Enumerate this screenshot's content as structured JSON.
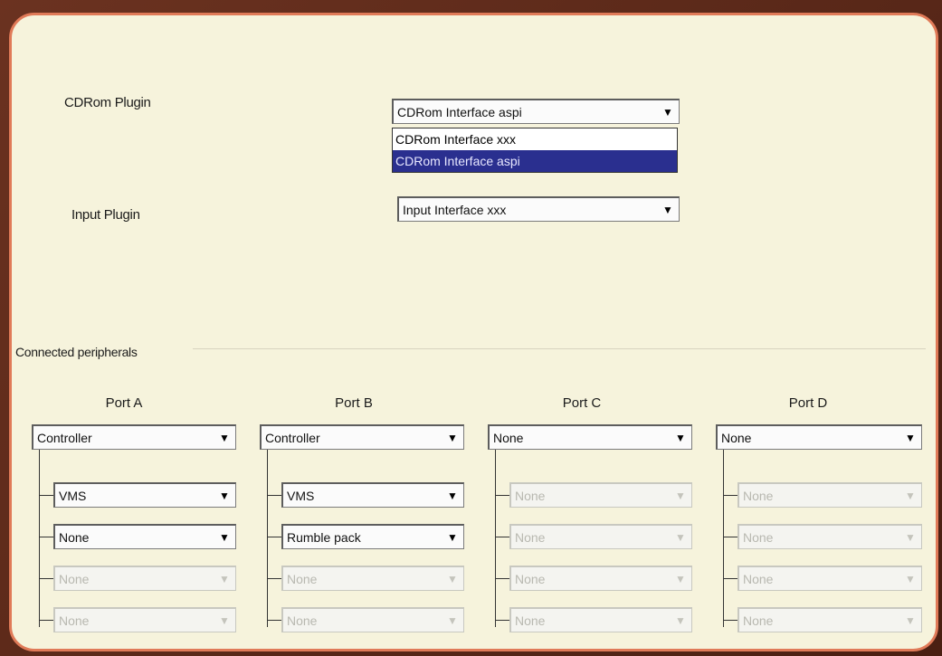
{
  "cdrom": {
    "label": "CDRom Plugin",
    "selected": "CDRom Interface aspi",
    "options": [
      "CDRom Interface xxx",
      "CDRom Interface aspi"
    ]
  },
  "input": {
    "label": "Input Plugin",
    "selected": "Input Interface xxx"
  },
  "peripherals": {
    "label": "Connected peripherals",
    "ports": [
      {
        "title": "Port A",
        "main": "Controller",
        "slots": [
          "VMS",
          "None",
          "None",
          "None"
        ]
      },
      {
        "title": "Port B",
        "main": "Controller",
        "slots": [
          "VMS",
          "Rumble pack",
          "None",
          "None"
        ]
      },
      {
        "title": "Port C",
        "main": "None",
        "slots": [
          "None",
          "None",
          "None",
          "None"
        ]
      },
      {
        "title": "Port D",
        "main": "None",
        "slots": [
          "None",
          "None",
          "None",
          "None"
        ]
      }
    ]
  },
  "icons": {
    "dropdown_arrow": "▼"
  },
  "colors": {
    "panel": "#f6f3dc",
    "border": "#e07a58",
    "selection": "#2a2f8f"
  }
}
